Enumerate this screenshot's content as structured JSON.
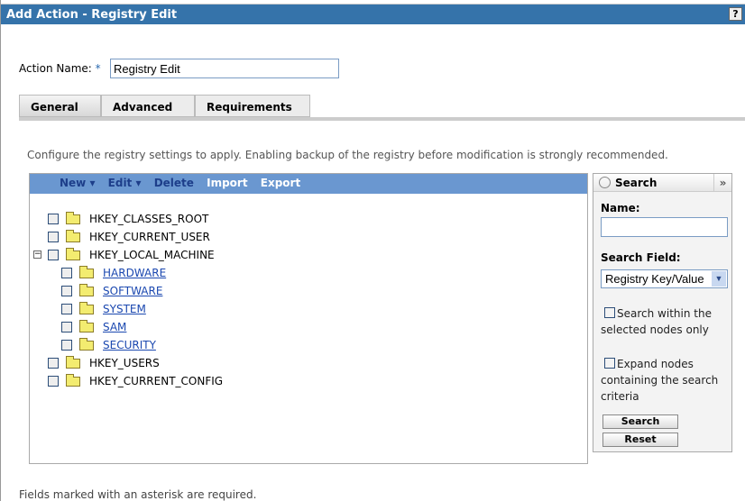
{
  "window": {
    "title": "Add Action - Registry Edit",
    "help_label": "?"
  },
  "form": {
    "action_name_label": "Action Name:",
    "required_mark": "*",
    "action_name_value": "Registry Edit"
  },
  "tabs": [
    {
      "label": "General",
      "active": true
    },
    {
      "label": "Advanced"
    },
    {
      "label": "Requirements"
    }
  ],
  "description": "Configure the registry settings to apply. Enabling backup of the registry before modification is strongly recommended.",
  "toolbar": {
    "new": "New ▾",
    "edit": "Edit ▾",
    "delete": "Delete",
    "import": "Import",
    "export": "Export"
  },
  "tree": [
    {
      "label": "HKEY_CLASSES_ROOT"
    },
    {
      "label": "HKEY_CURRENT_USER"
    },
    {
      "label": "HKEY_LOCAL_MACHINE",
      "expanded": true,
      "expander": "−"
    },
    {
      "label": "HARDWARE"
    },
    {
      "label": "SOFTWARE"
    },
    {
      "label": "SYSTEM"
    },
    {
      "label": "SAM"
    },
    {
      "label": "SECURITY"
    },
    {
      "label": "HKEY_USERS"
    },
    {
      "label": "HKEY_CURRENT_CONFIG"
    }
  ],
  "search": {
    "title": "Search",
    "collapse": "»",
    "name_label": "Name:",
    "name_value": "",
    "field_label": "Search Field:",
    "field_value": "Registry Key/Value",
    "field_arrow": "▼",
    "within_label": "Search within the selected nodes only",
    "expand_label": "Expand nodes containing the search criteria",
    "search_button": "Search",
    "reset_button": "Reset"
  },
  "footer": "Fields marked with an asterisk are required."
}
